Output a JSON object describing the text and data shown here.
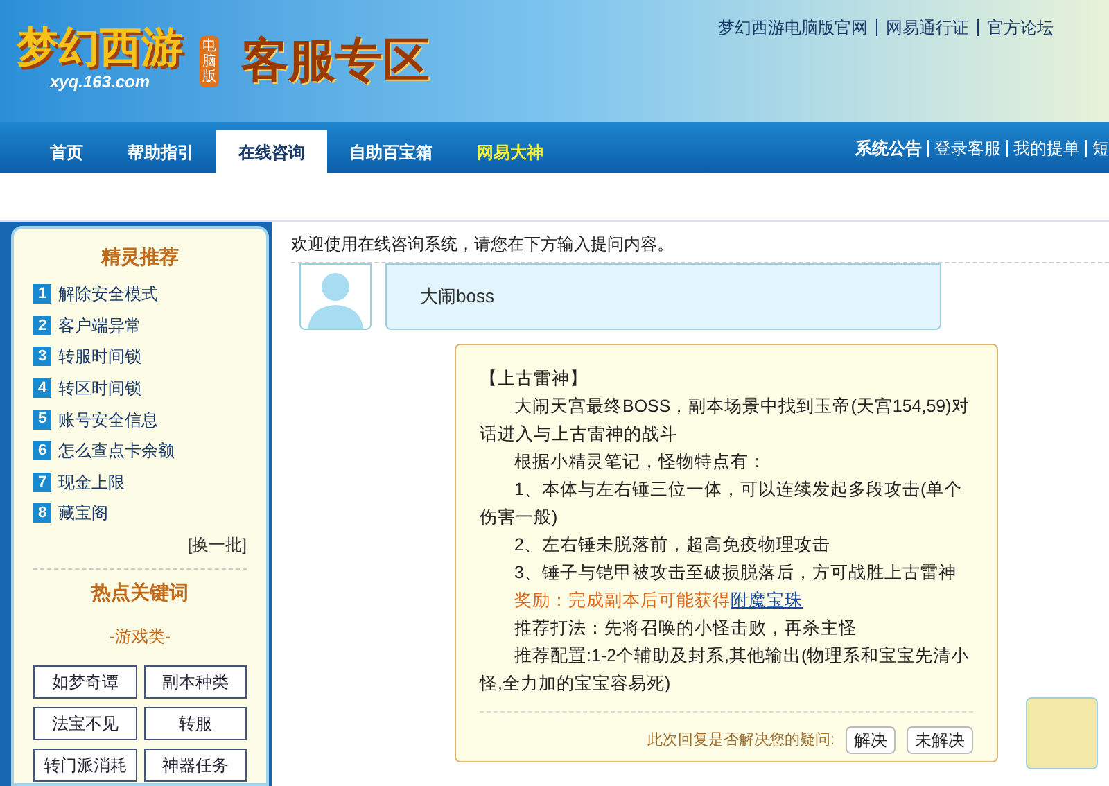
{
  "header": {
    "logo_text": "梦幻西游",
    "logo_badge": "电脑版",
    "logo_url": "xyq.163.com",
    "title": "客服专区",
    "top_links": [
      "梦幻西游电脑版官网",
      "网易通行证",
      "官方论坛"
    ]
  },
  "nav": {
    "tabs": [
      {
        "label": "首页",
        "selected": false,
        "kind": "normal"
      },
      {
        "label": "帮助指引",
        "selected": false,
        "kind": "normal"
      },
      {
        "label": "在线咨询",
        "selected": true,
        "kind": "normal"
      },
      {
        "label": "自助百宝箱",
        "selected": false,
        "kind": "normal"
      },
      {
        "label": "网易大神",
        "selected": false,
        "kind": "featured"
      }
    ],
    "right_links": [
      {
        "label": "系统公告",
        "kind": "bold"
      },
      {
        "label": "登录客服",
        "kind": "normal"
      },
      {
        "label": "我的提单",
        "kind": "normal"
      },
      {
        "label": "短",
        "kind": "normal"
      }
    ]
  },
  "sidebar": {
    "recommend": {
      "title": "精灵推荐",
      "items": [
        {
          "number": "1",
          "label": "解除安全模式"
        },
        {
          "number": "2",
          "label": "客户端异常"
        },
        {
          "number": "3",
          "label": "转服时间锁"
        },
        {
          "number": "4",
          "label": "转区时间锁"
        },
        {
          "number": "5",
          "label": "账号安全信息"
        },
        {
          "number": "6",
          "label": "怎么查点卡余额"
        },
        {
          "number": "7",
          "label": "现金上限"
        },
        {
          "number": "8",
          "label": "藏宝阁"
        }
      ],
      "more": "[换一批]"
    },
    "hot": {
      "title": "热点关键词",
      "category": "-游戏类-",
      "keywords": [
        "如梦奇谭",
        "副本种类",
        "法宝不见",
        "转服",
        "转门派消耗",
        "神器任务"
      ]
    }
  },
  "chat": {
    "welcome": "欢迎使用在线咨询系统，请您在下方输入提问内容。",
    "user_message": "大闹boss",
    "reply": {
      "heading": "【上古雷神】",
      "paragraphs": [
        {
          "kind": "text",
          "text": "大闹天宫最终BOSS，副本场景中找到玉帝(天宫154,59)对话进入与上古雷神的战斗"
        },
        {
          "kind": "text",
          "text": "根据小精灵笔记，怪物特点有："
        },
        {
          "kind": "text",
          "text": "1、本体与左右锤三位一体，可以连续发起多段攻击(单个伤害一般)"
        },
        {
          "kind": "text",
          "text": "2、左右锤未脱落前，超高免疫物理攻击"
        },
        {
          "kind": "text",
          "text": "3、锤子与铠甲被攻击至破损脱落后，方可战胜上古雷神"
        },
        {
          "kind": "reward",
          "text": "奖励：完成副本后可能获得",
          "link": "附魔宝珠"
        },
        {
          "kind": "text",
          "text": "推荐打法：先将召唤的小怪击败，再杀主怪"
        },
        {
          "kind": "text",
          "text": "推荐配置:1-2个辅助及封系,其他输出(物理系和宝宝先清小怪,全力加的宝宝容易死)"
        }
      ],
      "feedback_prompt": "此次回复是否解决您的疑问:",
      "buttons": [
        "解决",
        "未解决"
      ]
    }
  }
}
